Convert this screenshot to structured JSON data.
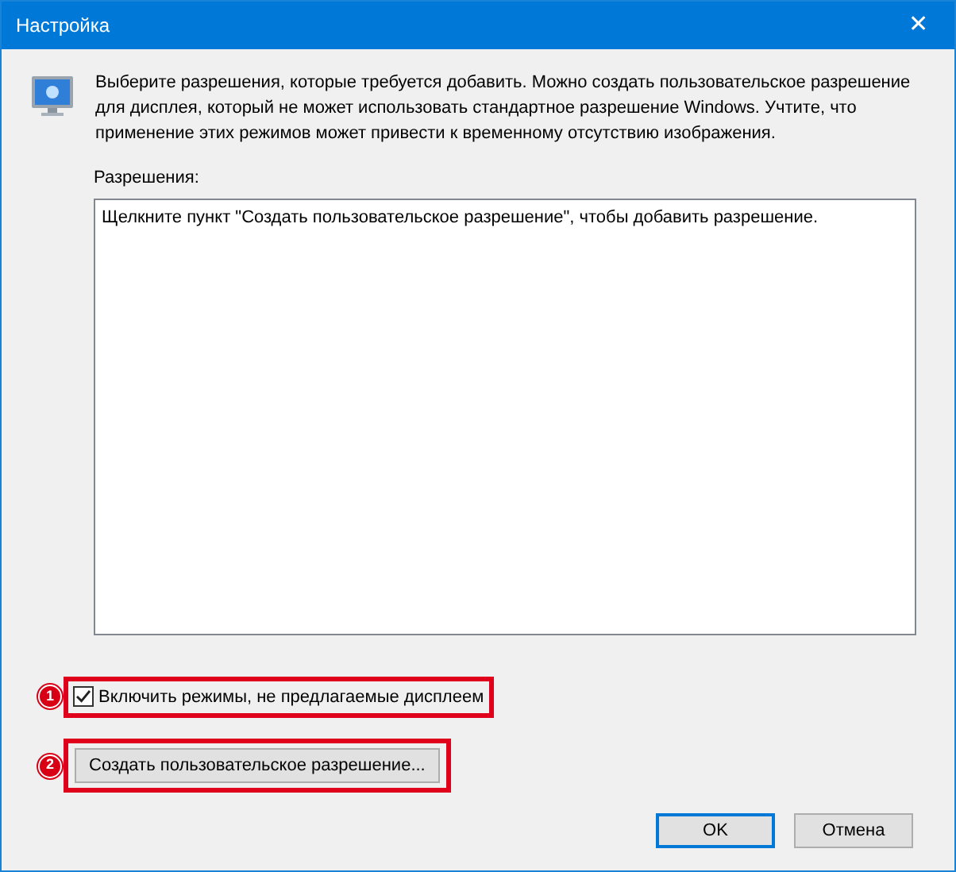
{
  "window": {
    "title": "Настройка",
    "close": "✕"
  },
  "intro": "Выберите разрешения, которые требуется добавить. Можно создать пользовательское разрешение для дисплея, который не может использовать стандартное разрешение Windows. Учтите, что применение этих режимов может привести к временному отсутствию изображения.",
  "resolutions": {
    "label": "Разрешения:",
    "items": [
      "Щелкните пункт \"Создать пользовательское разрешение\", чтобы добавить разрешение."
    ]
  },
  "checkbox": {
    "label": "Включить режимы, не предлагаемые дисплеем",
    "checked": true,
    "annotation": "1"
  },
  "custom_button": {
    "label": "Создать пользовательское разрешение...",
    "annotation": "2"
  },
  "buttons": [
    {
      "label": "OK",
      "default": true
    },
    {
      "label": "Отмена",
      "default": false
    }
  ]
}
